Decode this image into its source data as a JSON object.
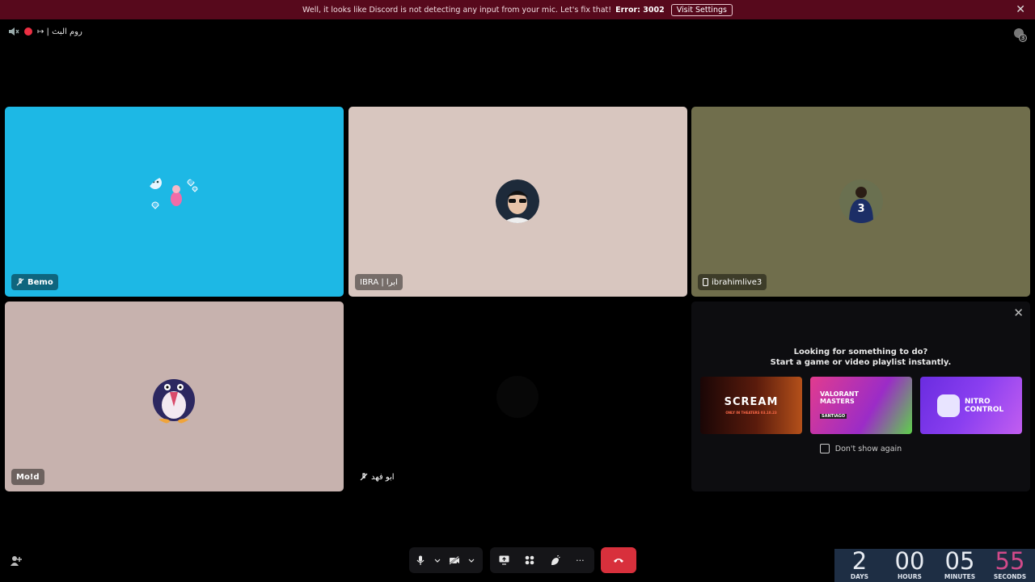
{
  "notice": {
    "message": "Well, it looks like Discord is not detecting any input from your mic. Let's fix that!",
    "error_code": "Error: 3002",
    "button": "Visit Settings",
    "close": "✕"
  },
  "channel": {
    "name": "روم البث | ↦"
  },
  "top_right": {
    "badge_count": "3"
  },
  "tiles": [
    {
      "name": "Bemo",
      "muted": true,
      "bg": "#1db8e5"
    },
    {
      "name": "IBRA | ابرا",
      "muted": false,
      "bg": "#d8c6bf"
    },
    {
      "name": "ibrahimlive3",
      "mobile": true,
      "bg": "#706e4c"
    },
    {
      "name": "Mo!d",
      "muted": false,
      "bg": "#c7b2ae"
    },
    {
      "name": "ابو فهد",
      "muted": true,
      "bg": "#000000"
    }
  ],
  "activity_panel": {
    "heading_line1": "Looking for something to do?",
    "heading_line2": "Start a game or video playlist instantly.",
    "cards": [
      {
        "title": "SCREAM",
        "subtitle": "ONLY IN THEATERS 03.10.23"
      },
      {
        "title": "VALORANT MASTERS",
        "subtitle": "SANTIAGO"
      },
      {
        "title": "NITRO CONTROL",
        "subtitle": ""
      }
    ],
    "checkbox_label": "Don't show again",
    "close": "✕"
  },
  "controls": {
    "more": "···"
  },
  "countdown": {
    "days": "2",
    "days_label": "DAYS",
    "hours": "00",
    "hours_label": "HOURS",
    "minutes": "05",
    "minutes_label": "MINUTES",
    "seconds": "55",
    "seconds_label": "SECONDS"
  },
  "colors": {
    "notice_bg": "#57091c",
    "hangup": "#d8303c",
    "countdown_bg": "#1e2e44",
    "seconds_accent": "#d24a8a"
  }
}
